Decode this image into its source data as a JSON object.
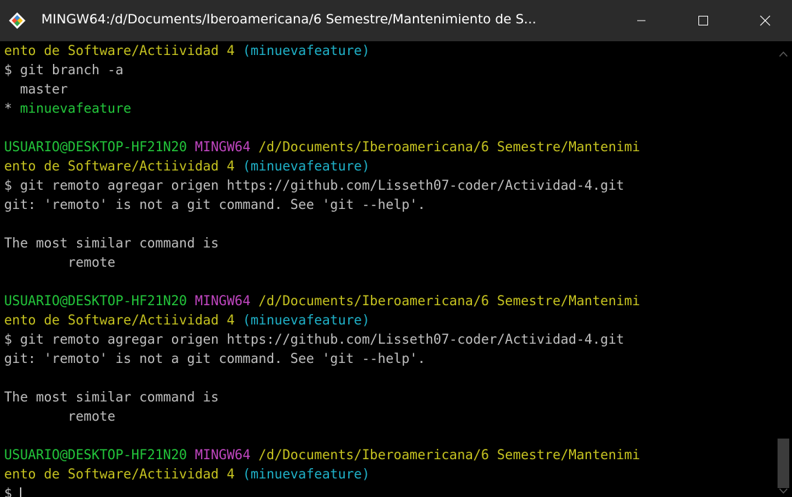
{
  "window": {
    "title": "MINGW64:/d/Documents/Iberoamericana/6 Semestre/Mantenimiento de S...",
    "icon": "git-bash-diamond-icon",
    "controls": [
      "minimize-icon",
      "maximize-icon",
      "close-icon"
    ]
  },
  "terminal": {
    "lines": [
      [
        {
          "t": "ento de Software/Actiividad 4 ",
          "c": "yellow"
        },
        {
          "t": "(minuevafeature)",
          "c": "cyan"
        }
      ],
      [
        {
          "t": "$ git branch -a",
          "c": "white"
        }
      ],
      [
        {
          "t": "  master",
          "c": "white"
        }
      ],
      [
        {
          "t": "* ",
          "c": "white"
        },
        {
          "t": "minuevafeature",
          "c": "green"
        }
      ],
      [],
      [
        {
          "t": "USUARIO@DESKTOP-HF21N20 ",
          "c": "green"
        },
        {
          "t": "MINGW64 ",
          "c": "magenta"
        },
        {
          "t": "/d/Documents/Iberoamericana/6 Semestre/Mantenimi",
          "c": "yellow"
        }
      ],
      [
        {
          "t": "ento de Software/Actiividad 4 ",
          "c": "yellow"
        },
        {
          "t": "(minuevafeature)",
          "c": "cyan"
        }
      ],
      [
        {
          "t": "$ git remoto agregar origen https://github.com/Lisseth07-coder/Actividad-4.git",
          "c": "white"
        }
      ],
      [
        {
          "t": "git: 'remoto' is not a git command. See 'git --help'.",
          "c": "white"
        }
      ],
      [],
      [
        {
          "t": "The most similar command is",
          "c": "white"
        }
      ],
      [
        {
          "t": "        remote",
          "c": "white"
        }
      ],
      [],
      [
        {
          "t": "USUARIO@DESKTOP-HF21N20 ",
          "c": "green"
        },
        {
          "t": "MINGW64 ",
          "c": "magenta"
        },
        {
          "t": "/d/Documents/Iberoamericana/6 Semestre/Mantenimi",
          "c": "yellow"
        }
      ],
      [
        {
          "t": "ento de Software/Actiividad 4 ",
          "c": "yellow"
        },
        {
          "t": "(minuevafeature)",
          "c": "cyan"
        }
      ],
      [
        {
          "t": "$ git remoto agregar origen https://github.com/Lisseth07-coder/Actividad-4.git",
          "c": "white"
        }
      ],
      [
        {
          "t": "git: 'remoto' is not a git command. See 'git --help'.",
          "c": "white"
        }
      ],
      [],
      [
        {
          "t": "The most similar command is",
          "c": "white"
        }
      ],
      [
        {
          "t": "        remote",
          "c": "white"
        }
      ],
      [],
      [
        {
          "t": "USUARIO@DESKTOP-HF21N20 ",
          "c": "green"
        },
        {
          "t": "MINGW64 ",
          "c": "magenta"
        },
        {
          "t": "/d/Documents/Iberoamericana/6 Semestre/Mantenimi",
          "c": "yellow"
        }
      ],
      [
        {
          "t": "ento de Software/Actiividad 4 ",
          "c": "yellow"
        },
        {
          "t": "(minuevafeature)",
          "c": "cyan"
        }
      ],
      [
        {
          "t": "$ ",
          "c": "white"
        }
      ]
    ]
  },
  "colors": {
    "background": "#000000",
    "titlebar": "#2b2b2b",
    "green": "#23c63b",
    "magenta": "#c046c0",
    "yellow": "#c6c320",
    "cyan": "#1fb1c8",
    "white": "#bfbfbf"
  },
  "scrollbar": {
    "position_fraction": 1.0
  }
}
